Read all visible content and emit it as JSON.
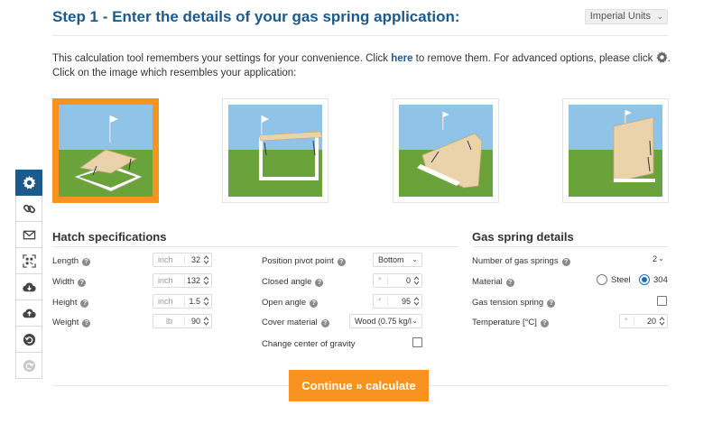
{
  "header": {
    "step_label": "Step 1",
    "step_title": " - Enter the details of your gas spring application:",
    "units": "Imperial Units"
  },
  "intro": {
    "line1_before": "This calculation tool remembers your settings for your convenience. Click ",
    "link_text": "here",
    "line1_after": " to remove them. For advanced options, please click ",
    "line2": "Click on the image which resembles your application:"
  },
  "applications": [
    {
      "icon": "hatch-horizontal-hinged-image",
      "selected": true
    },
    {
      "icon": "hatch-vertical-frame-image",
      "selected": false
    },
    {
      "icon": "hatch-inclined-image",
      "selected": false
    },
    {
      "icon": "door-vertical-image",
      "selected": false
    }
  ],
  "toolbar": [
    {
      "icon": "gear-icon",
      "active": true
    },
    {
      "icon": "link-icon",
      "active": false
    },
    {
      "icon": "mail-icon",
      "active": false
    },
    {
      "icon": "qr-code-icon",
      "active": false
    },
    {
      "icon": "cloud-download-icon",
      "active": false
    },
    {
      "icon": "cloud-upload-icon",
      "active": false
    },
    {
      "icon": "undo-icon",
      "active": false
    },
    {
      "icon": "redo-icon",
      "active": false
    }
  ],
  "hatch": {
    "title": "Hatch specifications",
    "length": {
      "label": "Length",
      "unit": "inch",
      "value": "32"
    },
    "width": {
      "label": "Width",
      "unit": "inch",
      "value": "132"
    },
    "height": {
      "label": "Height",
      "unit": "inch",
      "value": "1.5"
    },
    "weight": {
      "label": "Weight",
      "unit": "lb",
      "value": "90"
    },
    "pivot": {
      "label": "Position pivot point",
      "value": "Bottom"
    },
    "closed_angle": {
      "label": "Closed angle",
      "unit": "°",
      "value": "0"
    },
    "open_angle": {
      "label": "Open angle",
      "unit": "°",
      "value": "95"
    },
    "cover": {
      "label": "Cover material",
      "value": "Wood (0.75 kg/l"
    },
    "cog": {
      "label": "Change center of gravity",
      "checked": false
    }
  },
  "gas": {
    "title": "Gas spring details",
    "count": {
      "label": "Number of gas springs",
      "value": "2"
    },
    "material": {
      "label": "Material",
      "option1": "Steel",
      "option2": "304",
      "selected": "304"
    },
    "tension": {
      "label": "Gas tension spring",
      "checked": false
    },
    "temperature": {
      "label": "Temperature [°C]",
      "unit": "°",
      "value": "20"
    }
  },
  "continue_label": "Continue » calculate",
  "colors": {
    "primary": "#1d5a8c",
    "accent": "#f7931e"
  }
}
